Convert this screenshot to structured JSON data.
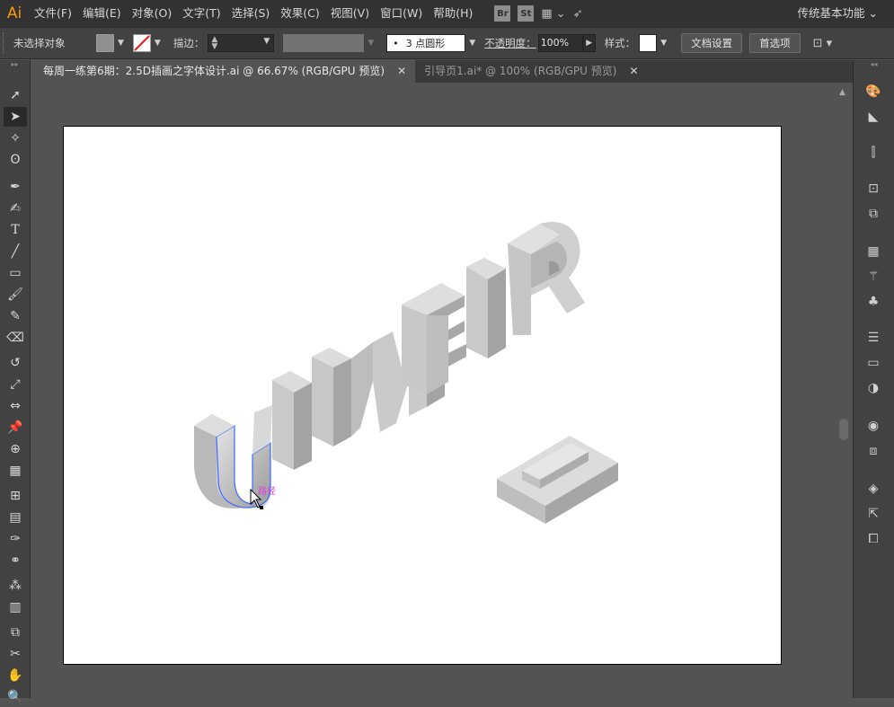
{
  "app": {
    "logo": "Ai"
  },
  "menu": {
    "items": [
      "文件(F)",
      "编辑(E)",
      "对象(O)",
      "文字(T)",
      "选择(S)",
      "效果(C)",
      "视图(V)",
      "窗口(W)",
      "帮助(H)"
    ],
    "ext": [
      "Br",
      "St"
    ],
    "workspace": "传统基本功能 ⌄"
  },
  "control": {
    "selection_status": "未选择对象",
    "stroke_label": "描边：",
    "brush_value": "3 点圆形",
    "brush_prefix": "•",
    "opacity_label": "不透明度：",
    "opacity_value": "100%",
    "style_label": "样式：",
    "doc_setup_button": "文档设置",
    "preferences_button": "首选项"
  },
  "tabs": [
    {
      "label": "每周一练第6期：2.5D插画之字体设计.ai @ 66.67% (RGB/GPU 预览)",
      "close": "✕"
    },
    {
      "label": "引导页1.ai* @ 100% (RGB/GPU 预览)",
      "close": "✕"
    }
  ],
  "artboard": {
    "path_hint": "路径",
    "lettering": "UIMEIR"
  },
  "colors": {
    "menubar_bg": "#323232",
    "panel_bg": "#424242",
    "canvas_bg": "#535353",
    "artboard_bg": "#ffffff",
    "accent_logo": "#ff9a00",
    "selection_stroke": "#3b6cff",
    "path_hint": "#e040e0",
    "letter_top": "#d8d8d8",
    "letter_front": "#bcbcbc",
    "letter_side": "#9d9d9d"
  }
}
